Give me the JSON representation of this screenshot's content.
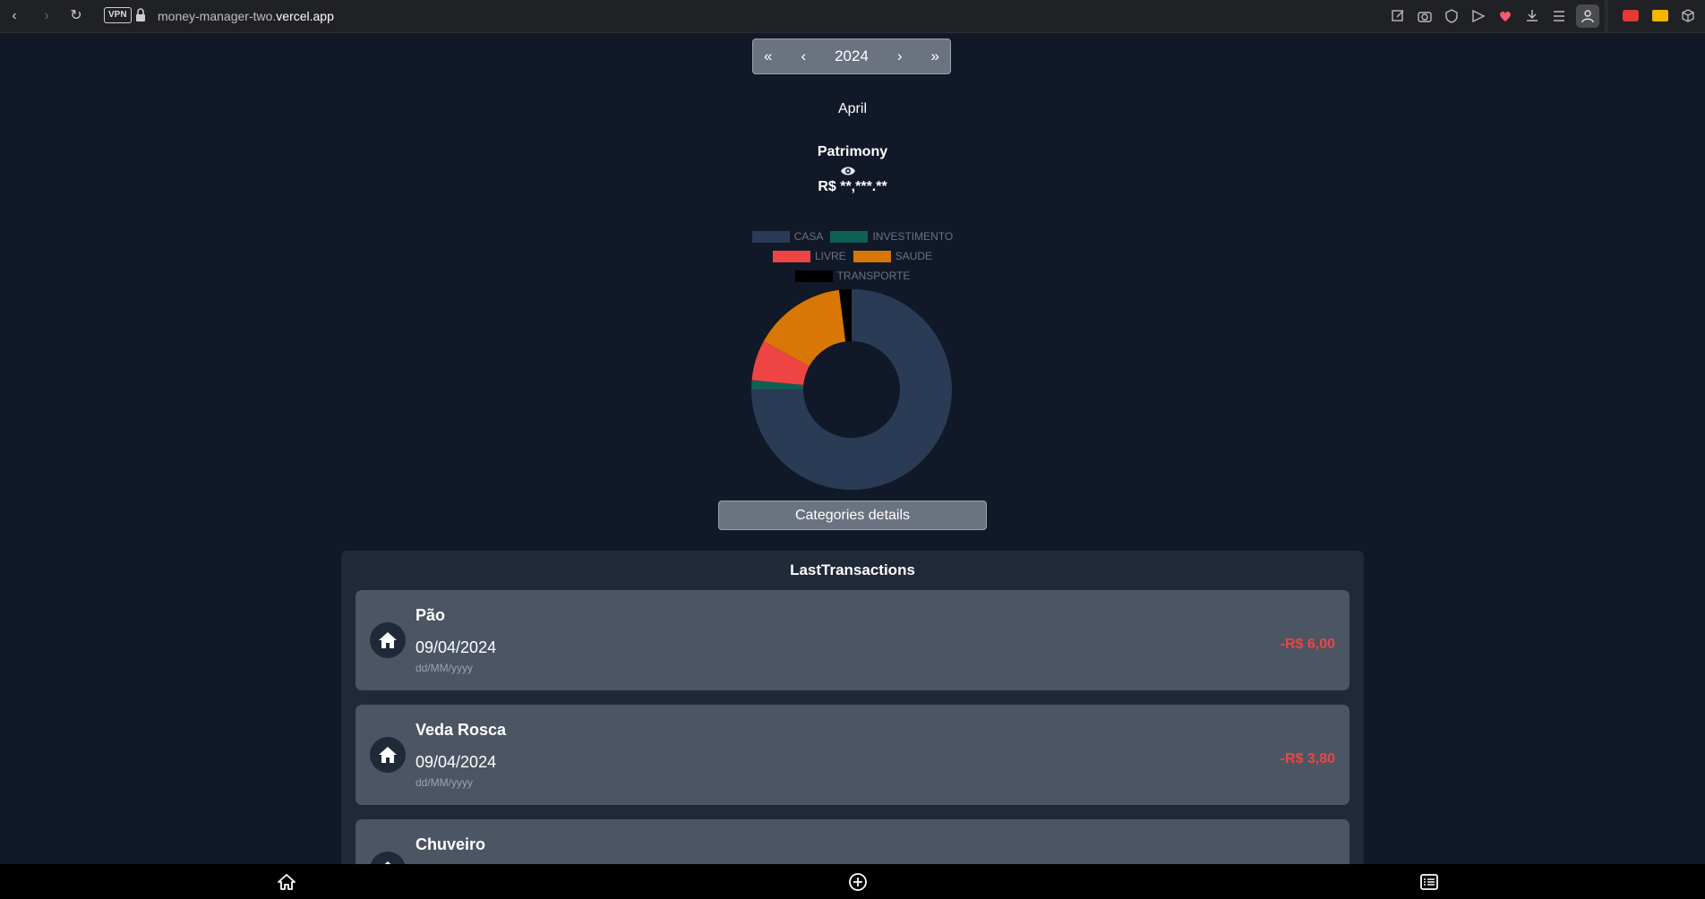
{
  "browser": {
    "vpn_label": "VPN",
    "url_prefix": "money-manager-two.",
    "url_domain": "vercel.app"
  },
  "year_nav": {
    "first": "«",
    "prev": "‹",
    "year": "2024",
    "next": "›",
    "last": "»"
  },
  "month": "April",
  "patrimony": {
    "label": "Patrimony",
    "value": "R$ **,***.**"
  },
  "chart_data": {
    "type": "pie",
    "categories": [
      "CASA",
      "INVESTIMENTO",
      "LIVRE",
      "SAUDE",
      "TRANSPORTE"
    ],
    "values": [
      75,
      1.5,
      6.5,
      15,
      2
    ],
    "colors": [
      "#2a3b55",
      "#0f5f55",
      "#ef4444",
      "#d97706",
      "#000000"
    ],
    "legend": "top"
  },
  "categories_button": "Categories details",
  "transactions": {
    "title": "LastTransactions",
    "items": [
      {
        "name": "Pão",
        "date": "09/04/2024",
        "format": "dd/MM/yyyy",
        "amount": "-R$ 6,00",
        "icon": "home-icon"
      },
      {
        "name": "Veda Rosca",
        "date": "09/04/2024",
        "format": "dd/MM/yyyy",
        "amount": "-R$ 3,80",
        "icon": "home-icon"
      },
      {
        "name": "Chuveiro",
        "date": "",
        "format": "",
        "amount": "",
        "icon": "home-icon"
      }
    ]
  },
  "colors": {
    "background": "#111827",
    "panel": "#1f2937",
    "card": "#4b5563",
    "button": "#6b7280",
    "negative": "#ef4444"
  }
}
